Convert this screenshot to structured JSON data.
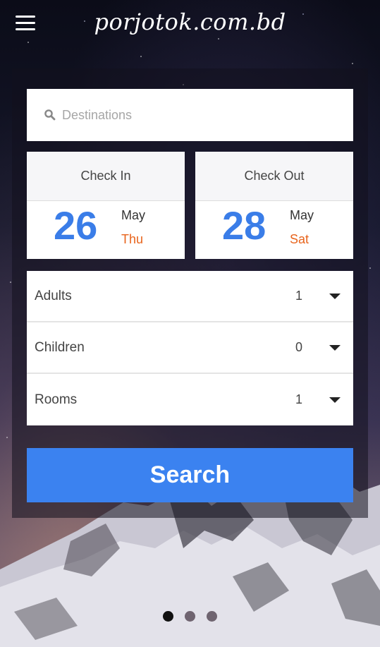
{
  "header": {
    "brand": "porjotok.com.bd"
  },
  "search": {
    "placeholder": "Destinations"
  },
  "check_in": {
    "label": "Check In",
    "day": "26",
    "month": "May",
    "weekday": "Thu"
  },
  "check_out": {
    "label": "Check Out",
    "day": "28",
    "month": "May",
    "weekday": "Sat"
  },
  "guests": [
    {
      "label": "Adults",
      "value": "1"
    },
    {
      "label": "Children",
      "value": "0"
    },
    {
      "label": "Rooms",
      "value": "1"
    }
  ],
  "search_button": "Search",
  "pager": {
    "active_index": 0,
    "count": 3
  },
  "colors": {
    "accent": "#3b82f0",
    "date_number": "#3a7de8",
    "weekday": "#e8641c"
  }
}
